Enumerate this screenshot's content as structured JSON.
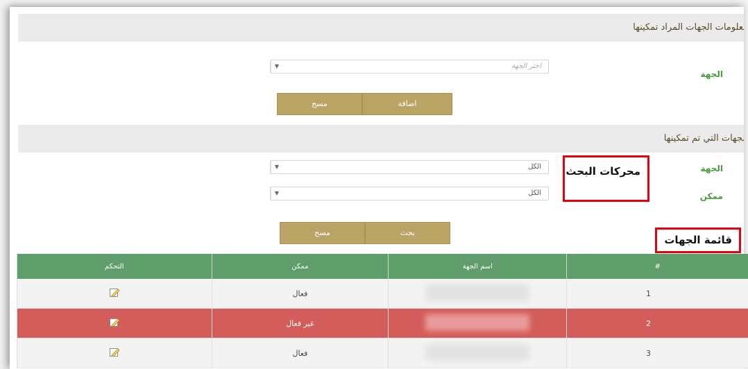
{
  "section1": {
    "title": "معلومات الجهات المراد تمكينها",
    "field_label": "الجهة",
    "select_placeholder": "اختر الجهة",
    "add_button": "اضافة",
    "clear_button": "مسح"
  },
  "section2": {
    "title": "الجهات التي تم تمكينها",
    "entity_label": "الجهة",
    "entity_value": "الكل",
    "enabled_label": "ممكن",
    "enabled_value": "الكل",
    "search_button": "بحث",
    "clear_button": "مسح"
  },
  "annotations": {
    "search_engines": "محركات البحث",
    "entities_list": "قائمة الجهات",
    "color": "#e3000f"
  },
  "table": {
    "headers": [
      "#",
      "اسم الجهة",
      "ممكن",
      "التحكم"
    ],
    "rows": [
      {
        "num": "1",
        "status": "فعال",
        "state": "active"
      },
      {
        "num": "2",
        "status": "غير فعال",
        "state": "inactive"
      },
      {
        "num": "3",
        "status": "فعال",
        "state": "active"
      }
    ],
    "colors": {
      "header": "#5f9e6b",
      "inactive_row": "#d35d5b",
      "button": "#b9a465"
    },
    "control_icon": "edit-icon"
  }
}
